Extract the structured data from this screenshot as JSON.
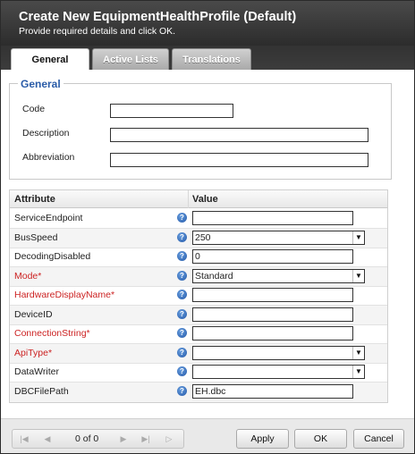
{
  "dialog": {
    "title": "Create New EquipmentHealthProfile (Default)",
    "subtitle": "Provide required details and click OK."
  },
  "tabs": [
    {
      "label": "General",
      "active": true
    },
    {
      "label": "Active Lists",
      "active": false
    },
    {
      "label": "Translations",
      "active": false
    }
  ],
  "general": {
    "legend": "General",
    "fields": [
      {
        "label": "Code",
        "value": ""
      },
      {
        "label": "Description",
        "value": ""
      },
      {
        "label": "Abbreviation",
        "value": ""
      }
    ]
  },
  "attributes": {
    "header_attribute": "Attribute",
    "header_value": "Value",
    "rows": [
      {
        "name": "ServiceEndpoint",
        "required": false,
        "type": "text",
        "value": ""
      },
      {
        "name": "BusSpeed",
        "required": false,
        "type": "select",
        "value": "250"
      },
      {
        "name": "DecodingDisabled",
        "required": false,
        "type": "text",
        "value": "0"
      },
      {
        "name": "Mode*",
        "required": true,
        "type": "select",
        "value": "Standard"
      },
      {
        "name": "HardwareDisplayName*",
        "required": true,
        "type": "text",
        "value": ""
      },
      {
        "name": "DeviceID",
        "required": false,
        "type": "text",
        "value": ""
      },
      {
        "name": "ConnectionString*",
        "required": true,
        "type": "text",
        "value": ""
      },
      {
        "name": "ApiType*",
        "required": true,
        "type": "select",
        "value": ""
      },
      {
        "name": "DataWriter",
        "required": false,
        "type": "select",
        "value": ""
      },
      {
        "name": "DBCFilePath",
        "required": false,
        "type": "text",
        "value": "EH.dbc"
      }
    ],
    "help_icon": "help-icon"
  },
  "pager": {
    "text": "0 of 0"
  },
  "buttons": {
    "apply": "Apply",
    "ok": "OK",
    "cancel": "Cancel"
  },
  "colors": {
    "header_bg": "#333333",
    "legend": "#2a5ca8",
    "required": "#cc2222"
  }
}
